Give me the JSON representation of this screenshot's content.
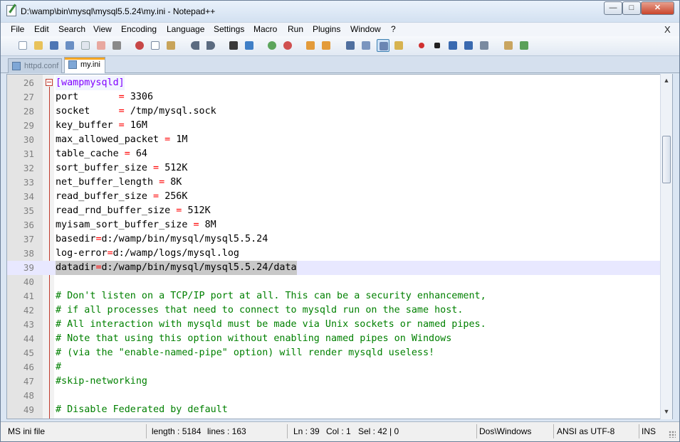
{
  "window": {
    "title": "D:\\wamp\\bin\\mysql\\mysql5.5.24\\my.ini - Notepad++",
    "min_icon": "minimize-icon",
    "max_icon": "maximize-icon",
    "close_icon": "close-icon"
  },
  "menu": {
    "items": [
      "File",
      "Edit",
      "Search",
      "View",
      "Encoding",
      "Language",
      "Settings",
      "Macro",
      "Run",
      "Plugins",
      "Window",
      "?"
    ],
    "close_label": "X"
  },
  "toolbar": {
    "icons": [
      "new-file-icon",
      "open-file-icon",
      "save-icon",
      "save-all-icon",
      "close-file-icon",
      "close-all-icon",
      "print-icon",
      "cut-icon",
      "copy-icon",
      "paste-icon",
      "undo-icon",
      "redo-icon",
      "find-icon",
      "replace-icon",
      "zoom-in-icon",
      "zoom-out-icon",
      "sync-vertical-icon",
      "sync-horizontal-icon",
      "word-wrap-icon",
      "show-all-chars-icon",
      "indent-guide-icon",
      "user-lang-icon",
      "record-macro-icon",
      "stop-record-icon",
      "play-macro-icon",
      "play-multiple-icon",
      "save-macro-icon",
      "trim-icon",
      "spell-check-icon"
    ]
  },
  "tabs": [
    {
      "label": "httpd.conf",
      "active": false,
      "icon": "saved-file-icon"
    },
    {
      "label": "my.ini",
      "active": true,
      "icon": "saved-file-icon"
    }
  ],
  "editor": {
    "current_line": 39,
    "lines": [
      {
        "n": "26",
        "text": "[wampmysqld]",
        "kind": "section"
      },
      {
        "n": "27",
        "key": "port      ",
        "sep": " = ",
        "val": "3306",
        "kind": "kv"
      },
      {
        "n": "28",
        "key": "socket    ",
        "sep": " = ",
        "val": "/tmp/mysql.sock",
        "kind": "kv"
      },
      {
        "n": "29",
        "key": "key_buffer",
        "sep": " = ",
        "val": "16M",
        "kind": "kv"
      },
      {
        "n": "30",
        "key": "max_allowed_packet",
        "sep": " = ",
        "val": "1M",
        "kind": "kv"
      },
      {
        "n": "31",
        "key": "table_cache",
        "sep": " = ",
        "val": "64",
        "kind": "kv"
      },
      {
        "n": "32",
        "key": "sort_buffer_size",
        "sep": " = ",
        "val": "512K",
        "kind": "kv"
      },
      {
        "n": "33",
        "key": "net_buffer_length",
        "sep": " = ",
        "val": "8K",
        "kind": "kv"
      },
      {
        "n": "34",
        "key": "read_buffer_size",
        "sep": " = ",
        "val": "256K",
        "kind": "kv"
      },
      {
        "n": "35",
        "key": "read_rnd_buffer_size",
        "sep": " = ",
        "val": "512K",
        "kind": "kv"
      },
      {
        "n": "36",
        "key": "myisam_sort_buffer_size",
        "sep": " = ",
        "val": "8M",
        "kind": "kv"
      },
      {
        "n": "37",
        "key": "basedir",
        "sep": "=",
        "val": "d:/wamp/bin/mysql/mysql5.5.24",
        "kind": "kv"
      },
      {
        "n": "38",
        "key": "log-error",
        "sep": "=",
        "val": "d:/wamp/logs/mysql.log",
        "kind": "kv"
      },
      {
        "n": "39",
        "key": "datadir",
        "sep": "=",
        "val": "d:/wamp/bin/mysql/mysql5.5.24/data",
        "kind": "kv"
      },
      {
        "n": "40",
        "text": "",
        "kind": "blank"
      },
      {
        "n": "41",
        "text": "# Don't listen on a TCP/IP port at all. This can be a security enhancement,",
        "kind": "comment"
      },
      {
        "n": "42",
        "text": "# if all processes that need to connect to mysqld run on the same host.",
        "kind": "comment"
      },
      {
        "n": "43",
        "text": "# All interaction with mysqld must be made via Unix sockets or named pipes.",
        "kind": "comment"
      },
      {
        "n": "44",
        "text": "# Note that using this option without enabling named pipes on Windows",
        "kind": "comment"
      },
      {
        "n": "45",
        "text": "# (via the \"enable-named-pipe\" option) will render mysqld useless!",
        "kind": "comment"
      },
      {
        "n": "46",
        "text": "#",
        "kind": "comment"
      },
      {
        "n": "47",
        "text": "#skip-networking",
        "kind": "comment"
      },
      {
        "n": "48",
        "text": "",
        "kind": "blank"
      },
      {
        "n": "49",
        "text": "# Disable Federated by default",
        "kind": "comment"
      }
    ]
  },
  "status": {
    "lang": "MS ini file",
    "length": "length : 5184",
    "lines": "lines : 163",
    "ln": "Ln : 39",
    "col": "Col : 1",
    "sel": "Sel : 42 | 0",
    "eol": "Dos\\Windows",
    "encoding": "ANSI as UTF-8",
    "mode": "INS"
  },
  "colors": {
    "section": "#8000ff",
    "comment": "#008000",
    "operator": "#ff0000",
    "current_line": "#e8e8ff"
  }
}
